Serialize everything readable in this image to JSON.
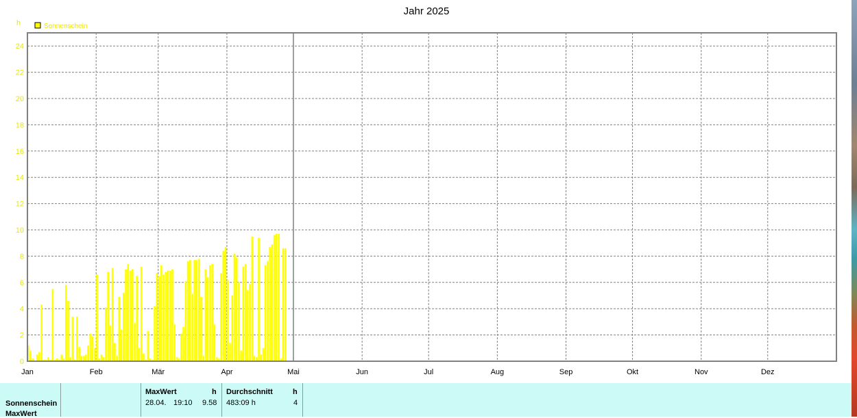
{
  "chart_data": {
    "type": "bar",
    "title": "Jahr 2025",
    "ylabel": "h",
    "ylim": [
      0,
      25
    ],
    "yticks": [
      0,
      2,
      4,
      6,
      8,
      10,
      12,
      14,
      16,
      18,
      20,
      22,
      24
    ],
    "xticks": [
      "Jan",
      "Feb",
      "Mär",
      "Apr",
      "Mai",
      "Jun",
      "Jul",
      "Aug",
      "Sep",
      "Okt",
      "Nov",
      "Dez"
    ],
    "grid": true,
    "legend_position": "top-left",
    "colors": {
      "bar": "#ffff00",
      "tick_label": "#e8e800",
      "axis": "#808080",
      "grid": "#808080"
    },
    "series": [
      {
        "name": "Sonnenschein",
        "days": [
          1,
          2,
          3,
          5,
          6,
          7,
          8,
          9,
          10,
          11,
          12,
          13,
          14,
          15,
          16,
          17,
          18,
          19,
          20,
          21,
          22,
          23,
          24,
          25,
          26,
          27,
          28,
          29,
          30,
          31,
          32,
          33,
          34,
          35,
          36,
          37,
          38,
          39,
          40,
          41,
          42,
          43,
          44,
          45,
          46,
          47,
          48,
          49,
          50,
          51,
          52,
          53,
          54,
          55,
          56,
          57,
          58,
          59,
          60,
          61,
          62,
          63,
          64,
          65,
          66,
          67,
          68,
          69,
          70,
          71,
          72,
          73,
          74,
          75,
          76,
          77,
          78,
          79,
          80,
          81,
          82,
          83,
          84,
          85,
          86,
          87,
          88,
          89,
          90,
          91,
          92,
          93,
          94,
          95,
          96,
          97,
          98,
          99,
          100,
          101,
          102,
          103,
          104,
          105,
          106,
          107,
          108,
          109,
          110,
          111,
          112,
          113,
          114,
          115,
          116,
          117,
          118,
          119,
          120
        ],
        "values": [
          1.2,
          0.8,
          0.2,
          0.5,
          0.7,
          4.3,
          0.1,
          0.1,
          0.3,
          0.1,
          5.5,
          0.1,
          0.2,
          0.1,
          0.5,
          0.2,
          5.8,
          4.6,
          0.3,
          3.4,
          0.1,
          3.4,
          1.1,
          0.4,
          0.4,
          0.5,
          1.2,
          2.1,
          1.9,
          1.0,
          6.6,
          0.2,
          0.5,
          0.3,
          4.1,
          6.8,
          2.7,
          7.1,
          1.4,
          0.4,
          4.9,
          2.4,
          5.2,
          7.0,
          7.4,
          6.9,
          7.0,
          2.9,
          6.5,
          1.0,
          7.2,
          0.6,
          0.1,
          2.3,
          0.2,
          0.1,
          4.2,
          6.7,
          6.5,
          7.3,
          6.6,
          6.8,
          6.9,
          6.9,
          7.0,
          2.8,
          0.3,
          0.2,
          2.1,
          2.6,
          6.1,
          7.6,
          7.7,
          5.1,
          7.7,
          7.7,
          7.8,
          4.9,
          0.4,
          7.0,
          6.4,
          7.3,
          7.4,
          2.8,
          0.3,
          0.2,
          6.7,
          8.4,
          8.7,
          6.2,
          1.4,
          5.0,
          8.2,
          7.9,
          6.0,
          0.8,
          7.2,
          7.4,
          5.4,
          5.9,
          9.5,
          0.4,
          0.3,
          9.4,
          0.5,
          1.0,
          7.3,
          7.6,
          8.7,
          8.9,
          9.6,
          9.7,
          9.7,
          0.2,
          8.6,
          8.6
        ]
      }
    ]
  },
  "table": {
    "row_label_1": "Sonnenschein",
    "row_label_2": "MaxWert",
    "col1_header": "MaxWert",
    "col1_unit": "h",
    "col1_date": "28.04.",
    "col1_time": "19:10",
    "col1_value": "9.58",
    "col2_header": "Durchschnitt",
    "col2_unit": "h",
    "col2_value": "483:09 h",
    "col2_count": "4"
  }
}
